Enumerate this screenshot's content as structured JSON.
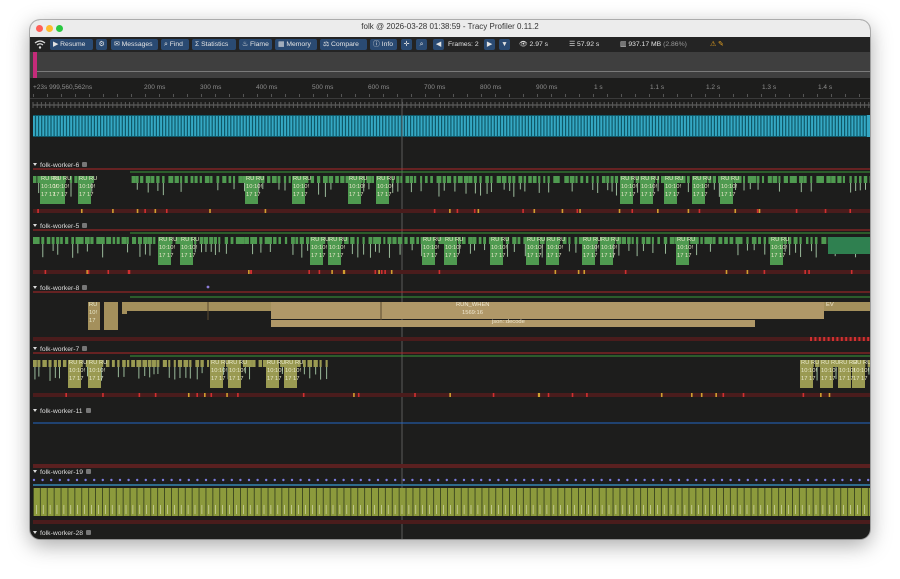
{
  "window": {
    "title": "folk @ 2026-03-28 01:38:59 - Tracy Profiler 0.11.2"
  },
  "toolbar": {
    "resume": "Resume",
    "messages": "Messages",
    "find": "Find",
    "statistics": "Statistics",
    "flame": "Flame",
    "memory": "Memory",
    "compare": "Compare",
    "info": "Info",
    "frames": "Frames: 2",
    "view_time": "2.97 s",
    "total_time": "57.92 s",
    "memory_usage": "937.17 MB",
    "memory_percent": "(2.86%)"
  },
  "ruler": {
    "ticks": [
      "+23s 999,560,562ns",
      "200 ms",
      "300 ms",
      "400 ms",
      "500 ms",
      "600 ms",
      "700 ms",
      "800 ms",
      "900 ms",
      "1 s",
      "1.1 s",
      "1.2 s",
      "1.3 s",
      "1.4 s"
    ]
  },
  "threads": [
    {
      "name": "folk-worker-6",
      "zone_text": [
        "RU RU",
        "10:10!",
        "17 17"
      ]
    },
    {
      "name": "folk-worker-5",
      "zone_text": [
        "RU RU",
        "10:10!",
        "17 17"
      ]
    },
    {
      "name": "folk-worker-8",
      "zone_text": [
        "RU",
        "10!",
        "17"
      ],
      "long_zone": {
        "name": "RUN_WHEN",
        "detail": "1569:16",
        "child": "json::decode",
        "tail": "EV"
      }
    },
    {
      "name": "folk-worker-7",
      "zone_text": [
        "RU RU",
        "10:10!",
        "17 17"
      ]
    },
    {
      "name": "folk-worker-11"
    },
    {
      "name": "folk-worker-19"
    },
    {
      "name": "folk-worker-28"
    }
  ],
  "colors": {
    "accent_button": "#2a4a72",
    "frame_strip": "#35a8c4",
    "zone_green": "#4f9a50",
    "zone_olive": "#9a9a52",
    "zone_tan": "#b09868",
    "mutex_red": "#b02828",
    "lock_blue": "#2466c4",
    "overview_pink": "#c42b7a"
  },
  "icons": [
    "wifi-icon",
    "play-icon",
    "gear-icon",
    "message-icon",
    "search-icon",
    "statistics-icon",
    "flame-icon",
    "memory-icon",
    "compare-icon",
    "info-icon",
    "crosshair-icon",
    "zoom-icon",
    "arrow-left-icon",
    "arrow-right-icon",
    "arrow-down-icon",
    "eye-icon",
    "database-icon",
    "memory-chip-icon",
    "warning-icon"
  ]
}
